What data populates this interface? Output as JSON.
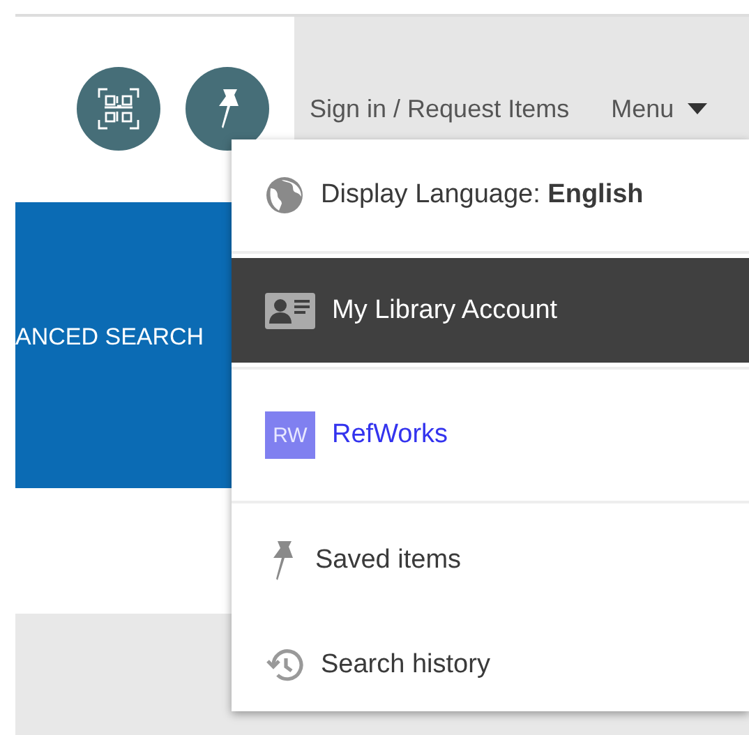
{
  "header": {
    "sign_in": "Sign in / Request Items",
    "menu": {
      "label": "Menu",
      "expanded": true
    }
  },
  "search_panel": {
    "advanced_search": "ANCED SEARCH"
  },
  "menu_items": [
    {
      "kind": "language",
      "label": "Display Language: **English**",
      "highlighted": false
    },
    {
      "kind": "account",
      "label": "My Library Account",
      "highlighted": true
    },
    {
      "kind": "refworks",
      "label": "RefWorks",
      "badge": "RW",
      "highlighted": false
    },
    {
      "kind": "saved",
      "label": "Saved items",
      "highlighted": false
    },
    {
      "kind": "history",
      "label": "Search history",
      "highlighted": false
    }
  ]
}
